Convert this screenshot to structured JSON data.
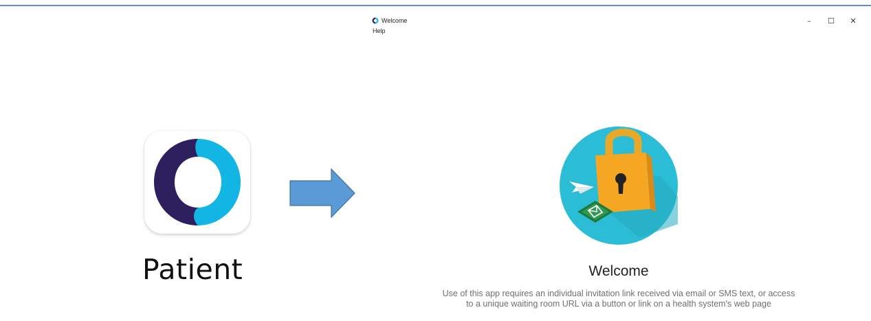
{
  "window": {
    "title": "Welcome",
    "menu": [
      "Help"
    ],
    "controls": {
      "minimize": "–",
      "maximize": "☐",
      "close": "✕"
    }
  },
  "patient_app": {
    "label": "Patient",
    "icon_colors": {
      "left": "#2e1f5e",
      "right": "#1ab7e6"
    }
  },
  "arrow": {
    "icon": "right-arrow-icon",
    "color": "#5b9bd5"
  },
  "welcome": {
    "heading": "Welcome",
    "body": "Use of this app requires an individual invitation link received via email or SMS text, or access to a unique waiting room URL via a button or link on a health system's web page",
    "illustration": "padlock-icon",
    "colors": {
      "circle": "#2bbdd6",
      "lock": "#f5a623",
      "shackle": "#e8a92b",
      "envelope_tile": "#1f7a3d"
    }
  }
}
